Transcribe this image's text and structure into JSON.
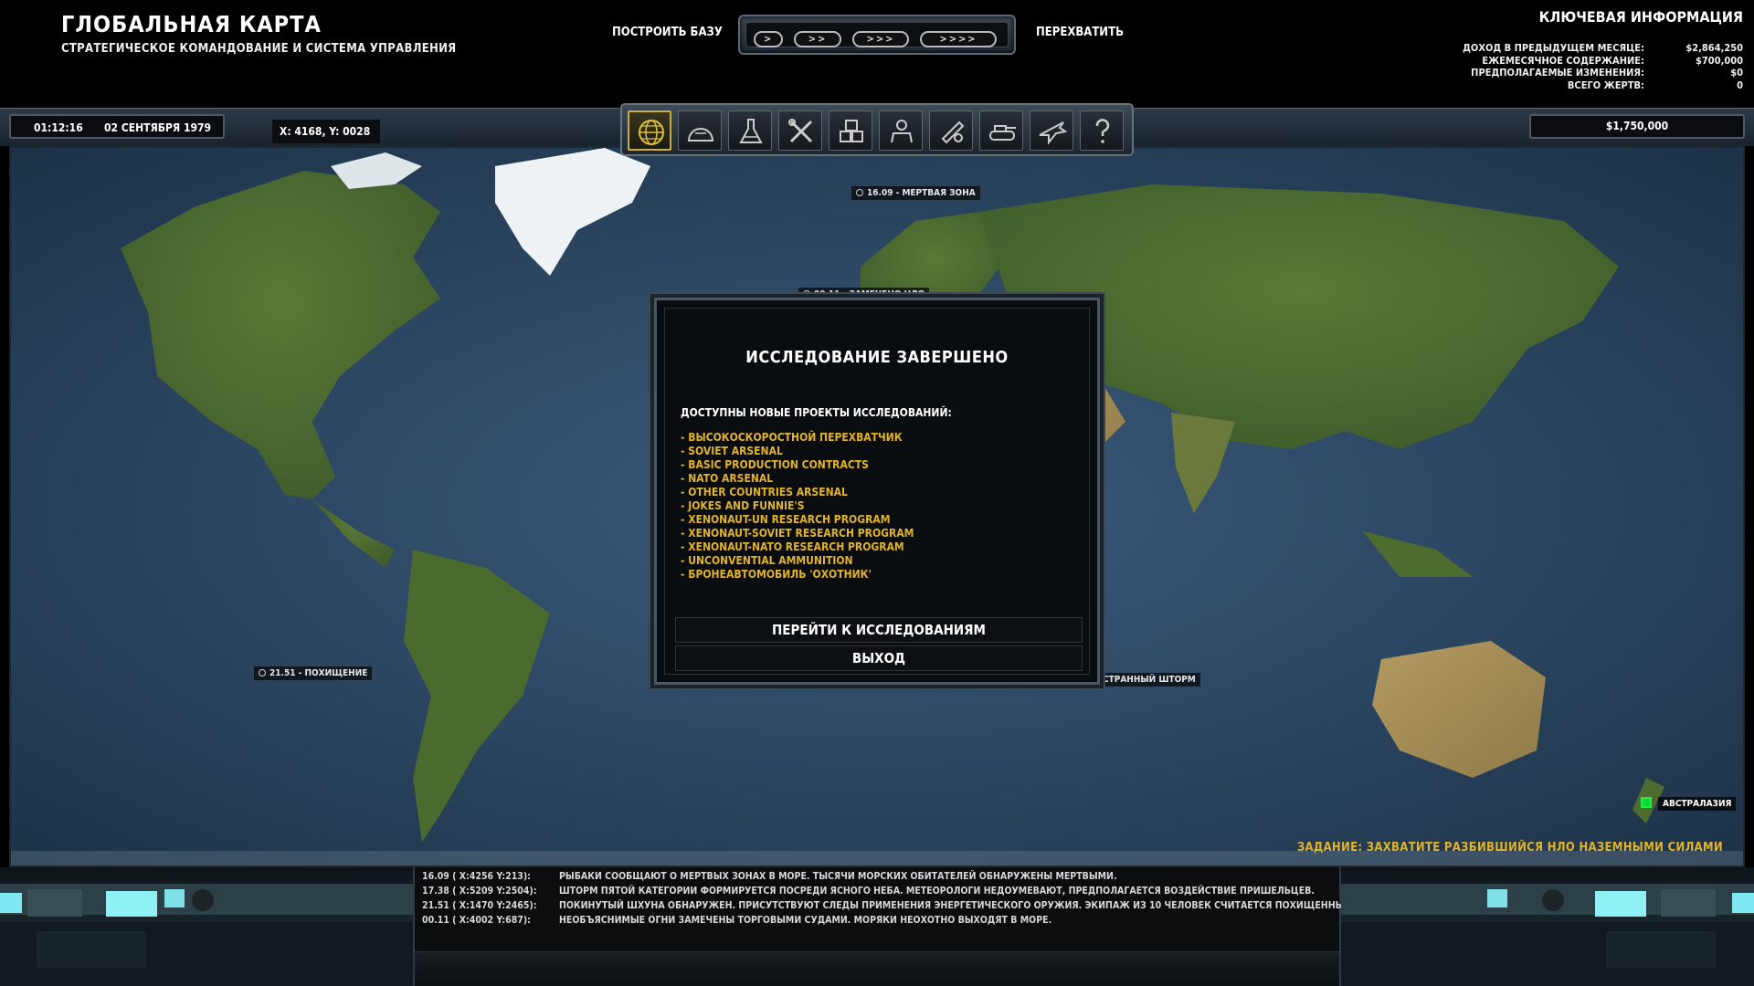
{
  "header": {
    "title": "ГЛОБАЛЬНАЯ КАРТА",
    "subtitle": "СТРАТЕГИЧЕСКОЕ КОМАНДОВАНИЕ И СИСТЕМА УПРАВЛЕНИЯ",
    "build_base": "ПОСТРОИТЬ БАЗУ",
    "intercept": "ПЕРЕХВАТИТЬ",
    "speed": [
      ">",
      ">>",
      ">>>",
      ">>>>"
    ]
  },
  "key_info": {
    "title": "КЛЮЧЕВАЯ ИНФОРМАЦИЯ",
    "rows": [
      {
        "label": "ДОХОД В ПРЕДЫДУЩЕМ МЕСЯЦЕ:",
        "value": "$2,864,250"
      },
      {
        "label": "ЕЖЕМЕСЯЧНОЕ СОДЕРЖАНИЕ:",
        "value": "$700,000"
      },
      {
        "label": "ПРЕДПОЛАГАЕМЫЕ ИЗМЕНЕНИЯ:",
        "value": "$0"
      },
      {
        "label": "ВСЕГО ЖЕРТВ:",
        "value": "0"
      }
    ]
  },
  "status": {
    "time": "01:12:16",
    "date": "02 СЕНТЯБРЯ 1979",
    "coords": "X: 4168, Y: 0028",
    "funds": "$1,750,000"
  },
  "toolbar": {
    "items": [
      "globe-icon",
      "dome-icon",
      "flask-icon",
      "tools-icon",
      "crates-icon",
      "soldier-icon",
      "aircraft-lock-icon",
      "tank-icon",
      "jet-icon",
      "help-icon"
    ]
  },
  "map": {
    "markers": [
      {
        "text": "16.09 - МЕРТВАЯ ЗОНА"
      },
      {
        "text": "00.11 - ЗАМЕЧЕНО НЛО"
      },
      {
        "text": "21.51 - ПОХИЩЕНИЕ"
      },
      {
        "text": "СТРАННЫЙ ШТОРМ"
      }
    ],
    "region": "АВСТРАЛАЗИЯ",
    "mission": "ЗАДАНИЕ: ЗАХВАТИТЕ РАЗБИВШИЙСЯ НЛО НАЗЕМНЫМИ СИЛАМИ"
  },
  "dialog": {
    "title": "ИССЛЕДОВАНИЕ ЗАВЕРШЕНО",
    "subtitle": "ДОСТУПНЫ НОВЫЕ ПРОЕКТЫ ИССЛЕДОВАНИЙ:",
    "items": [
      "- ВЫСОКОСКОРОСТНОЙ ПЕРЕХВАТЧИК",
      "- SOVIET ARSENAL",
      "- BASIC PRODUCTION CONTRACTS",
      "- NATO ARSENAL",
      "- OTHER COUNTRIES ARSENAL",
      "- JOKES AND FUNNIE'S",
      "- XENONAUT-UN RESEARCH PROGRAM",
      "- XENONAUT-SOVIET RESEARCH PROGRAM",
      "- XENONAUT-NATO RESEARCH PROGRAM",
      "- UNCONVENTIAL AMMUNITION",
      "- БРОНЕАВТОМОБИЛЬ 'ОХОТНИК'"
    ],
    "go_research": "ПЕРЕЙТИ К ИССЛЕДОВАНИЯМ",
    "exit": "ВЫХОД"
  },
  "log": [
    {
      "coords": "16.09 ( X:4256 Y:213):",
      "msg": "РЫБАКИ СООБЩАЮТ О МЕРТВЫХ ЗОНАХ В МОРЕ. ТЫСЯЧИ МОРСКИХ ОБИТАТЕЛЕЙ ОБНАРУЖЕНЫ МЕРТВЫМИ."
    },
    {
      "coords": "17.38 ( X:5209 Y:2504):",
      "msg": "ШТОРМ ПЯТОЙ КАТЕГОРИИ ФОРМИРУЕТСЯ ПОСРЕДИ ЯСНОГО НЕБА. МЕТЕОРОЛОГИ НЕДОУМЕВАЮТ, ПРЕДПОЛАГАЕТСЯ ВОЗДЕЙСТВИЕ ПРИШЕЛЬЦЕВ."
    },
    {
      "coords": "21.51 ( X:1470 Y:2465):",
      "msg": "ПОКИНУТЫЙ ШХУНА ОБНАРУЖЕН. ПРИСУТСТВУЮТ СЛЕДЫ ПРИМЕНЕНИЯ ЭНЕРГЕТИЧЕСКОГО ОРУЖИЯ. ЭКИПАЖ ИЗ 10 ЧЕЛОВЕК СЧИТАЕТСЯ ПОХИЩЕННЫМ."
    },
    {
      "coords": "00.11 ( X:4002 Y:687):",
      "msg": "НЕОБЪЯСНИМЫЕ ОГНИ ЗАМЕЧЕНЫ ТОРГОВЫМИ СУДАМИ. МОРЯКИ НЕОХОТНО ВЫХОДЯТ В МОРЕ."
    }
  ],
  "colors": {
    "accent": "#e2b42a",
    "ocean": "#2a4560",
    "land": "#4a6a30",
    "frame": "#4c5864"
  }
}
